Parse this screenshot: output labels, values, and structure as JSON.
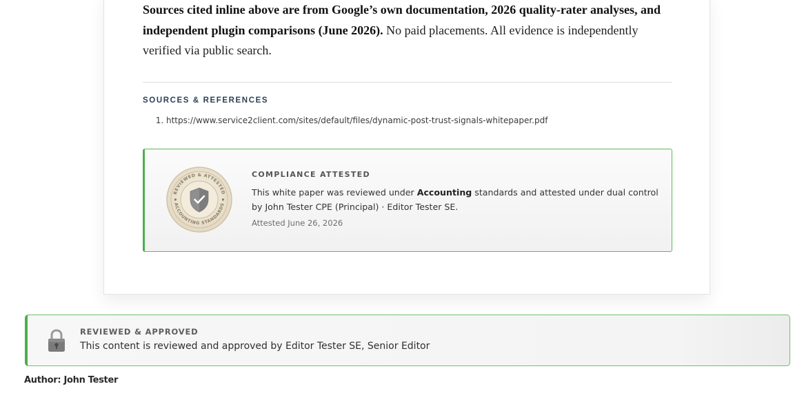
{
  "closing_note": {
    "bold_text": "Sources cited inline above are from Google’s own documentation, 2026 quality-rater analyses, and independent plugin comparisons (June 2026).",
    "regular_text": " No paid placements. All evidence is independently verified via public search."
  },
  "sources": {
    "title": "SOURCES & REFERENCES",
    "items": [
      "https://www.service2client.com/sites/default/files/dynamic-post-trust-signals-whitepaper.pdf"
    ]
  },
  "compliance": {
    "title": "COMPLIANCE ATTESTED",
    "body_prefix": "This white paper was reviewed under ",
    "standard": "Accounting",
    "body_suffix": " standards and attested under dual control by John Tester CPE (Principal) · Editor Tester SE.",
    "date": "Attested June 26, 2026",
    "seal": {
      "top_text": "REVIEWED & ATTESTED",
      "bottom_text": "ACCOUNTING STANDARDS",
      "icon": "shield-check-icon"
    },
    "accent_color": "#4cae4c"
  },
  "approved": {
    "title": "REVIEWED & APPROVED",
    "body": "This content is reviewed and approved by Editor Tester SE, Senior Editor",
    "icon": "lock-icon"
  },
  "author": "Author: John Tester"
}
